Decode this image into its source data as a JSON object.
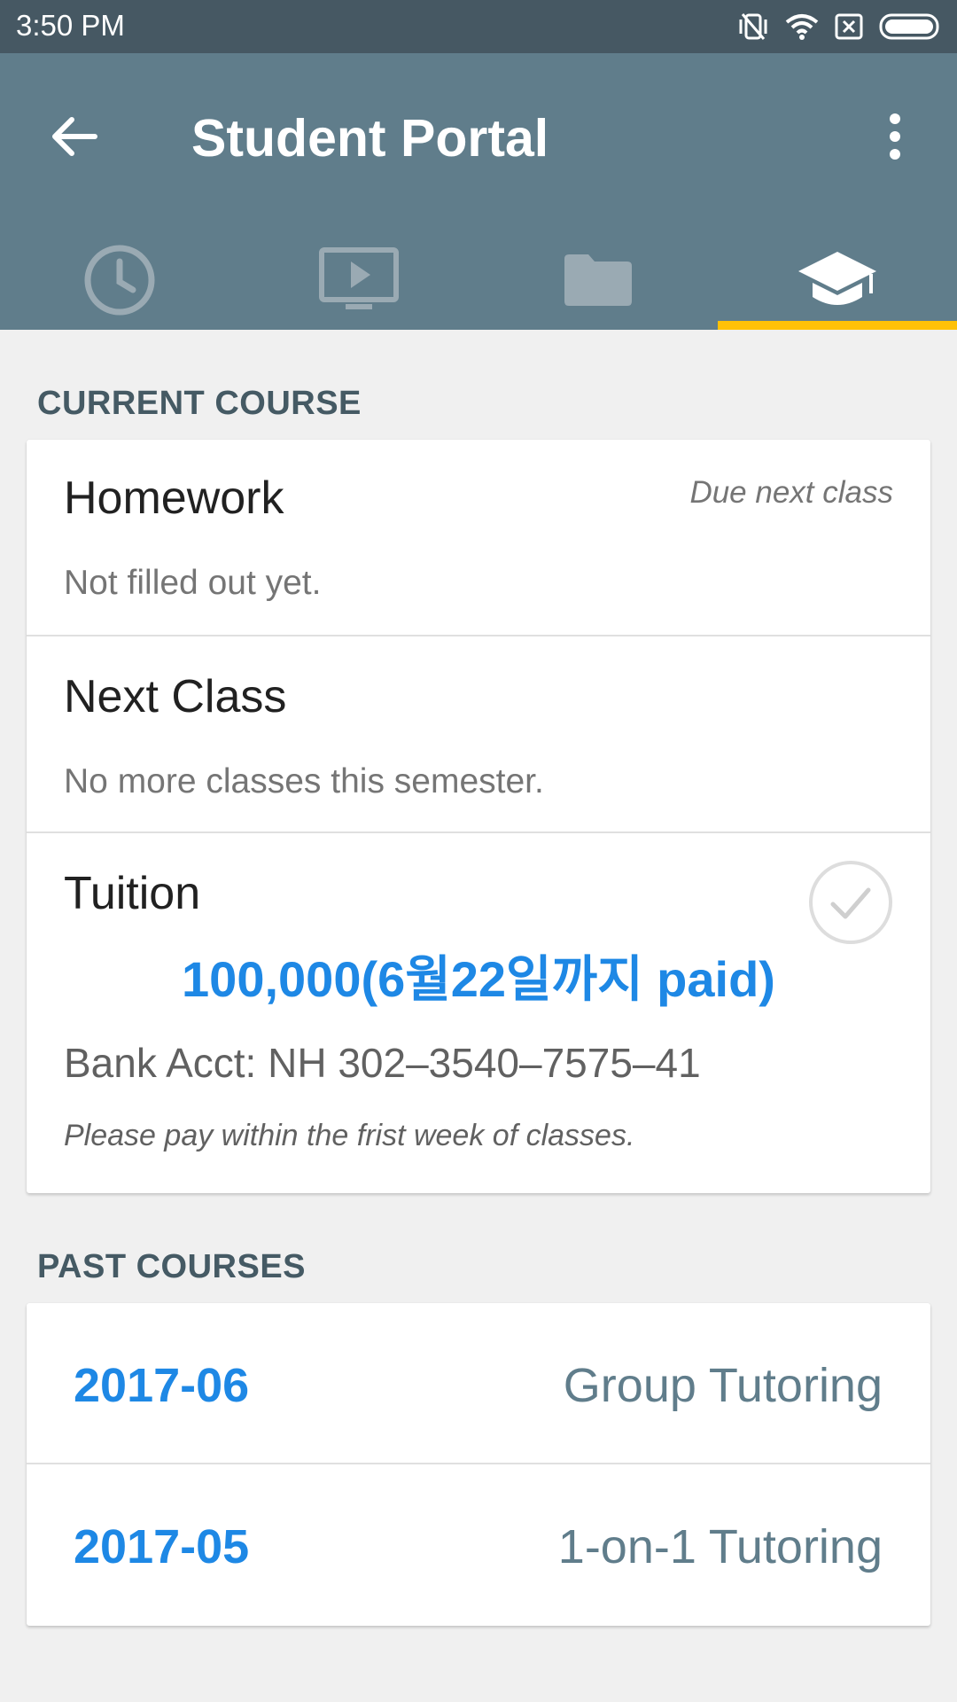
{
  "status_bar": {
    "time": "3:50 PM",
    "icons": [
      "vibrate-off-icon",
      "wifi-icon",
      "sim-off-icon",
      "battery-icon"
    ]
  },
  "app_bar": {
    "title": "Student Portal",
    "back_icon": "arrow-back-icon",
    "menu_icon": "more-vert-icon",
    "background": "#607d8b"
  },
  "tabs": [
    {
      "icon": "clock-icon",
      "active": false
    },
    {
      "icon": "video-icon",
      "active": false
    },
    {
      "icon": "folder-icon",
      "active": false
    },
    {
      "icon": "graduation-cap-icon",
      "active": true
    }
  ],
  "current_course": {
    "header": "CURRENT COURSE",
    "homework": {
      "title": "Homework",
      "due": "Due next class",
      "status": "Not filled out yet."
    },
    "next_class": {
      "title": "Next Class",
      "status": "No more classes this semester."
    },
    "tuition": {
      "title": "Tuition",
      "amount": "100,000(6월22일까지 paid)",
      "bank": "Bank Acct: NH 302–3540–7575–41",
      "note": "Please pay within the frist week of classes."
    }
  },
  "past_courses": {
    "header": "PAST COURSES",
    "items": [
      {
        "date": "2017-06",
        "type": "Group Tutoring"
      },
      {
        "date": "2017-05",
        "type": "1-on-1 Tutoring"
      }
    ]
  },
  "colors": {
    "accent": "#ffc107",
    "link": "#1e88e5",
    "status_bar": "#465863"
  }
}
